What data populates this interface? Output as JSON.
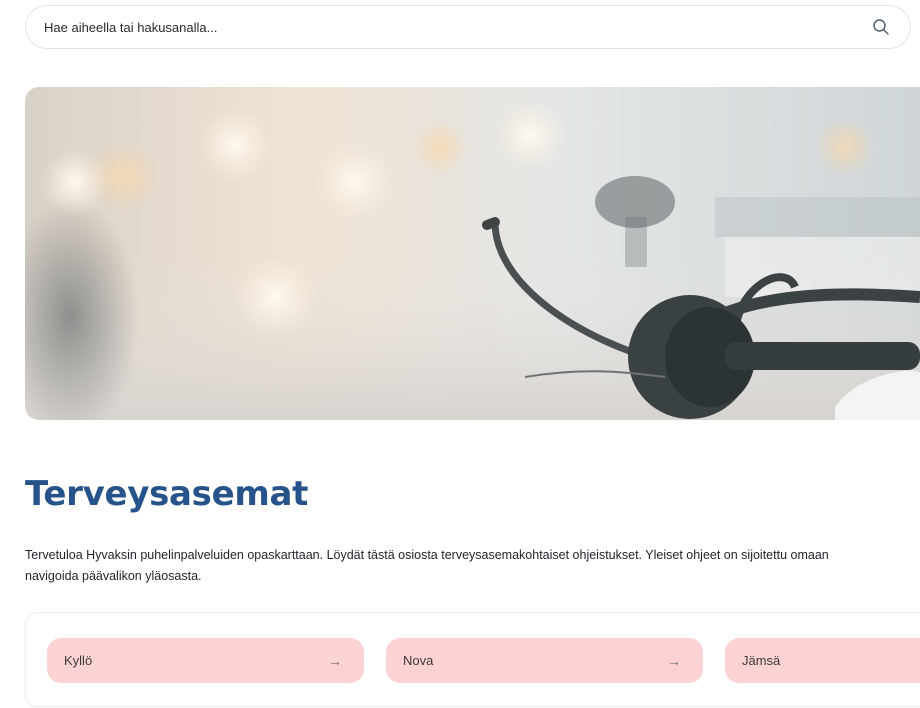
{
  "search": {
    "placeholder": "Hae aiheella tai hakusanalla...",
    "icon": "search-icon"
  },
  "hero": {
    "image": "headset-on-desk-photo"
  },
  "page": {
    "title": "Terveysasemat",
    "intro_line1": "Tervetuloa Hyvaksin puhelinpalveluiden opaskarttaan. Löydät tästä osiosta terveysasemakohtaiset ohjeistukset. Yleiset ohjeet on sijoitettu omaan",
    "intro_line2": "navigoida päävalikon yläosasta."
  },
  "cards": [
    {
      "label": "Kyllö",
      "arrow": "→"
    },
    {
      "label": "Nova",
      "arrow": "→"
    },
    {
      "label": "Jämsä",
      "arrow": ""
    }
  ],
  "colors": {
    "title": "#26548a",
    "card_bg": "#fdd2d2"
  }
}
